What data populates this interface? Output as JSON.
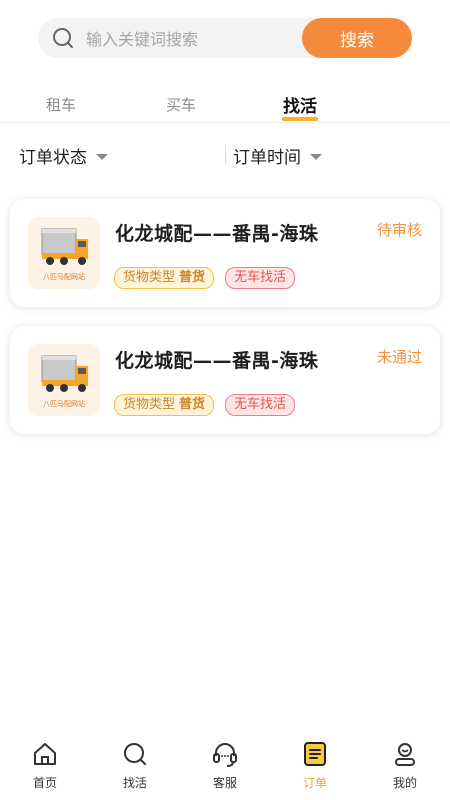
{
  "search": {
    "placeholder": "输入关键词搜索",
    "button_label": "搜索"
  },
  "tabs": [
    {
      "label": "租车",
      "active": false
    },
    {
      "label": "买车",
      "active": false
    },
    {
      "label": "找活",
      "active": true
    }
  ],
  "filters": [
    {
      "label": "订单状态"
    },
    {
      "label": "订单时间"
    }
  ],
  "orders": [
    {
      "title": "化龙城配——番禺-海珠",
      "status": "待审核",
      "thumb_caption": "八匹马配网站",
      "tag_type_label": "货物类型",
      "tag_type_value": "普货",
      "tag_mode": "无车找活"
    },
    {
      "title": "化龙城配——番禺-海珠",
      "status": "未通过",
      "thumb_caption": "八匹马配网站",
      "tag_type_label": "货物类型",
      "tag_type_value": "普货",
      "tag_mode": "无车找活"
    }
  ],
  "nav": [
    {
      "label": "首页",
      "icon": "home-icon",
      "active": false
    },
    {
      "label": "找活",
      "icon": "search-icon",
      "active": false
    },
    {
      "label": "客服",
      "icon": "headset-icon",
      "active": false
    },
    {
      "label": "订单",
      "icon": "order-list-icon",
      "active": true
    },
    {
      "label": "我的",
      "icon": "user-icon",
      "active": false
    }
  ],
  "colors": {
    "accent_orange": "#f58a3c",
    "tab_underline": "#f5b32a",
    "status_orange": "#f0913f",
    "nav_active": "#f5a623"
  }
}
